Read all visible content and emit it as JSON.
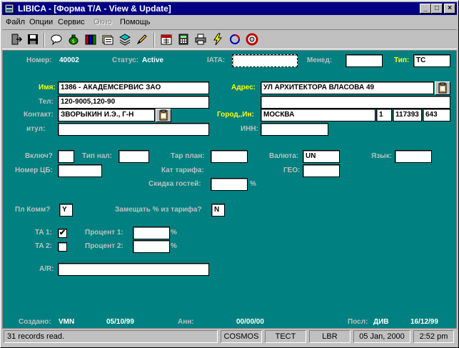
{
  "window": {
    "title": "LIBICA - [Форма Т/А - View & Update]",
    "minimize_glyph": "_",
    "restore_glyph": "□",
    "close_glyph": "×"
  },
  "menu": {
    "items": [
      "Файл",
      "Опции",
      "Сервис",
      "Окно",
      "Помощь"
    ],
    "disabled": [
      "Окно"
    ]
  },
  "toolbar": {
    "icons": [
      "exit-icon",
      "save-icon",
      "chat-icon",
      "money-bag-icon",
      "books-icon",
      "folders-icon",
      "stack-icon",
      "pencil-icon",
      "calendar-icon",
      "calculator-icon",
      "printer-icon",
      "lightning-icon",
      "recycle-icon",
      "lifebuoy-icon"
    ]
  },
  "form": {
    "nomer_label": "Номер:",
    "nomer_value": "40002",
    "status_label": "Статус:",
    "status_value": "Active",
    "iata_label": "IATA:",
    "iata_value": "",
    "manager_label": "Менед:",
    "manager_value": "",
    "type_label": "Тип:",
    "type_value": "TC",
    "name_label": "Имя:",
    "name_value": "1386 - АКАДЕМСЕРВИС ЗАО",
    "address_label": "Адрес:",
    "address_value": "УЛ АРХИТЕКТОРА ВЛАСОВА 49",
    "address2_value": "",
    "phone_label": "Тел:",
    "phone_value": "120-9005,120-90",
    "contact_label": "Контакт:",
    "contact_value": "ЗВОРЫКИН И.Э., Г-Н",
    "city_label": "Город,,Ин:",
    "city_value": "МОСКВА",
    "city_code": "1",
    "zip_value": "117393",
    "zip_ext_value": "643",
    "title_label": "итул:",
    "title_value": "",
    "inn_label": "ИНН:",
    "inn_value": "",
    "include_label": "Включ?",
    "include_value": "",
    "tax_type_label": "Тип нал:",
    "tax_type_value": "",
    "tar_plan_label": "Тар план:",
    "tar_plan_value": "",
    "currency_label": "Валюта:",
    "currency_value": "UN",
    "language_label": "Язык:",
    "language_value": "",
    "cb_label": "Номер ЦБ:",
    "cb_value": "",
    "tariff_cat_label": "Кат тарифа:",
    "geo_label": "ГЕО:",
    "geo_value": "",
    "guest_discount_label": "Скидка гостей:",
    "guest_discount_value": "",
    "percent_sign": "%",
    "pl_komm_label": "Пл Комм?",
    "pl_komm_value": "Y",
    "replace_label": "Замещать % из тарифа?",
    "replace_value": "N",
    "ta1_label": "TA 1:",
    "ta1_checked": "✔",
    "ta2_label": "TA 2:",
    "ta2_checked": "",
    "pct1_label": "Процент 1:",
    "pct1_value": "",
    "pct2_label": "Процент 2:",
    "pct2_value": "",
    "ar_label": "A/R:",
    "ar_value": "",
    "created_label": "Создано:",
    "created_by": "VMN",
    "created_date": "05/10/99",
    "ann_label": "Анн:",
    "ann_date": "00/00/00",
    "last_label": "Посл:",
    "last_by": "ДИВ",
    "last_date": "16/12/99"
  },
  "status": {
    "message": "31 records read.",
    "db": "COSMOS",
    "env": "TECT",
    "user": "LBR",
    "date": "05 Jan, 2000",
    "time": "2:52 pm"
  }
}
